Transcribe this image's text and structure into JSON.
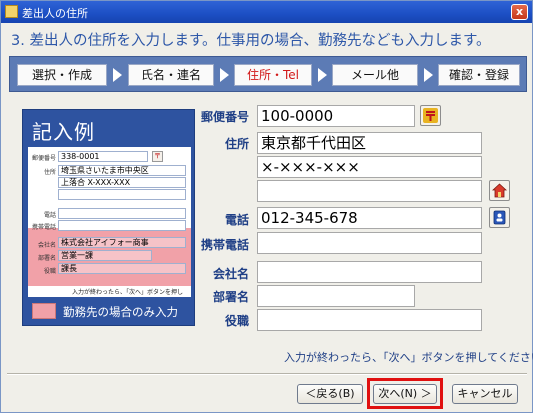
{
  "window": {
    "title": "差出人の住所",
    "close_label": "x"
  },
  "heading": "3. 差出人の住所を入力します。仕事用の場合、勤務先なども入力します。",
  "steps": [
    {
      "label": "選択・作成",
      "active": false
    },
    {
      "label": "氏名・連名",
      "active": false
    },
    {
      "label": "住所・Tel",
      "active": true
    },
    {
      "label": "メール他",
      "active": false
    },
    {
      "label": "確認・登録",
      "active": false
    }
  ],
  "sample": {
    "title": "記入例",
    "postal_label": "郵便番号",
    "postal": "338-0001",
    "address_label": "住所",
    "address1": "埼玉県さいたま市中央区",
    "address2": "上落合 X-XXX-XXX",
    "phone_label": "電話",
    "mobile_label": "携帯電話",
    "company_label": "会社名",
    "company": "株式会社アイフォー商事",
    "dept_label": "部署名",
    "dept": "営業一課",
    "role_label": "役職",
    "role": "課長",
    "note": "入力が終わったら、「次へ」ボタンを押し",
    "legend": "勤務先の場合のみ入力"
  },
  "form": {
    "postal_label": "郵便番号",
    "postal_value": "100-0000",
    "address_label": "住所",
    "address1_value": "東京都千代田区",
    "address2_value": "×-×××-×××",
    "address3_value": "",
    "phone_label": "電話",
    "phone_value": "012-345-678",
    "mobile_label": "携帯電話",
    "mobile_value": "",
    "company_label": "会社名",
    "company_value": "",
    "dept_label": "部署名",
    "dept_value": "",
    "role_label": "役職",
    "role_value": ""
  },
  "hint": "入力が終わったら、「次へ」ボタンを押してください。",
  "buttons": {
    "back": "＜戻る(B)",
    "next": "次へ(N) ＞",
    "cancel": "キャンセル"
  },
  "colors": {
    "accent": "#2d57a8",
    "active_step": "#d21919",
    "highlight": "#e01010",
    "sample_bg": "#2e53a0",
    "work_only": "#f1a1a8"
  },
  "icons": {
    "postal_lookup": "postal-mark-icon",
    "address_lookup": "house-icon",
    "phone_lookup": "address-book-icon"
  }
}
